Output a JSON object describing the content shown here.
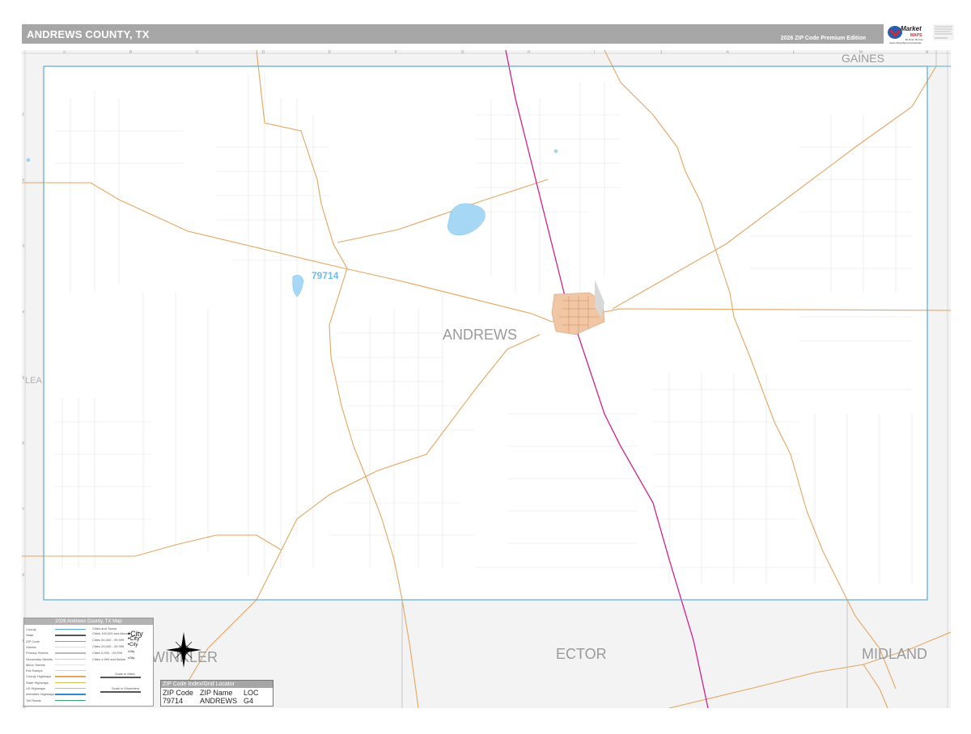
{
  "header": {
    "title": "ANDREWS COUNTY, TX",
    "edition": "2026 ZIP Code Premium Edition"
  },
  "logo": {
    "brand_word": "Market",
    "maps_word": "MAPS",
    "tagline_1": "Be Smart. Be Sure.",
    "tagline_2": "Good-Looking Maps & Accurate Data"
  },
  "grid": {
    "columns": [
      "A",
      "B",
      "C",
      "D",
      "E",
      "F",
      "G",
      "H",
      "I",
      "J",
      "K",
      "L",
      "M",
      "N"
    ],
    "rows": [
      "1",
      "2",
      "3",
      "4",
      "5",
      "6",
      "7",
      "8",
      "9",
      "10"
    ]
  },
  "map": {
    "county_name": "ANDREWS",
    "zip_label": "79714",
    "neighbors": {
      "gaines": "GAINES",
      "lea": "LEA",
      "winkler": "WINKLER",
      "ector": "ECTOR",
      "midland": "MIDLAND"
    },
    "colors": {
      "county_border": "#5aa9d6",
      "us_highway": "#e8a85a",
      "interstate_like": "#d0208f",
      "streets": "#d9d9d9",
      "water": "#9fd3f2",
      "city": "#f1c09a",
      "neighbor_fill": "#f2f2f2",
      "frame": "#999999"
    }
  },
  "legend": {
    "title": "2026 Andrews County, TX Map",
    "items": [
      "County",
      "State",
      "ZIP Code",
      "Streets",
      "Primary Streets",
      "Secondary Streets",
      "Minor Streets",
      "Exit Ramps",
      "County Highways",
      "State Highways",
      "US Highways",
      "Interstate Highways",
      "Toll Roads"
    ],
    "cities_heading": "Cities and Towns",
    "city_classes": [
      {
        "label": "Cities 100,000 and Above",
        "sample": "City"
      },
      {
        "label": "Cities 50,000 - 99,999",
        "sample": "City"
      },
      {
        "label": "Cities 25,000 - 49,999",
        "sample": "City"
      },
      {
        "label": "Cities 5,000 - 24,999",
        "sample": "City"
      },
      {
        "label": "Cities 4,999 and Below",
        "sample": "City"
      }
    ],
    "scale_miles": "Scale in Miles",
    "scale_km": "Scale in Kilometers"
  },
  "zip_index": {
    "title": "ZIP Code Index/Grid Locator",
    "headers": [
      "ZIP Code",
      "ZIP Name",
      "LOC"
    ],
    "rows": [
      [
        "79714",
        "ANDREWS",
        "G4"
      ]
    ]
  }
}
